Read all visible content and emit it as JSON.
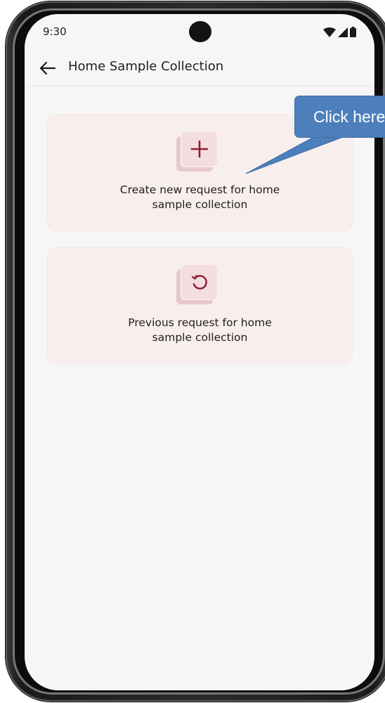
{
  "status_bar": {
    "time": "9:30",
    "icons": [
      "wifi-icon",
      "signal-icon",
      "battery-icon"
    ]
  },
  "app_bar": {
    "back_icon": "arrow-left-icon",
    "title": "Home Sample Collection"
  },
  "cards": [
    {
      "icon": "plus-icon",
      "label_line1": "Create new request for home",
      "label_line2": "sample collection"
    },
    {
      "icon": "history-icon",
      "label_line1": "Previous request for home",
      "label_line2": "sample collection"
    }
  ],
  "callout": {
    "text": "Click here"
  },
  "colors": {
    "accent": "#8b1f2e",
    "card_bg": "#f9eeee",
    "callout_bg": "#4c7fbc"
  }
}
